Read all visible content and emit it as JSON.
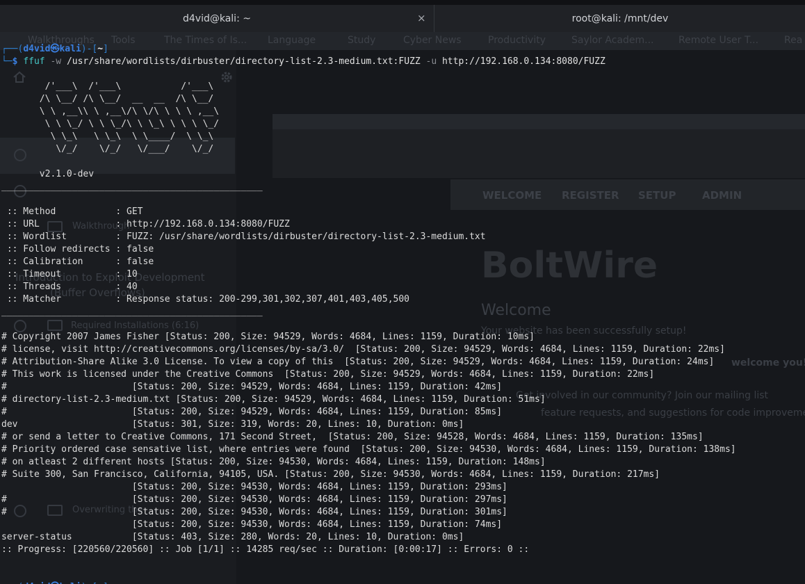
{
  "tabs": [
    {
      "title": "d4vid@kali: ~",
      "active": true,
      "close_glyph": "×"
    },
    {
      "title": "root@kali: /mnt/dev",
      "active": false
    }
  ],
  "ghost": {
    "bookmarks": [
      "Walkthroughs",
      "Tools",
      "The Times of Is...",
      "Language",
      "Study",
      "Cyber News",
      "Productivity",
      "Saylor Academ...",
      "Remote User T...",
      "Rea"
    ],
    "sidebar_items": [
      "Introduction to Exploit Development",
      "(Buffer Overflows)",
      "Required Installations (6:16)",
      "Walkthrough",
      "Overwriting the"
    ],
    "nav": [
      "WELCOME",
      "REGISTER",
      "SETUP",
      "ADMIN"
    ],
    "site_title": "BoltWire",
    "site_welcome": "Welcome",
    "site_setup": "Your website has been successfully setup!",
    "site_welcome_you": "welcome you!",
    "site_community": "Get involved in our community? Join our mailing list",
    "site_feature": "feature requests, and suggestions for code improvement a"
  },
  "prompt": {
    "user": "d4vid",
    "at": "㉿",
    "host": "kali",
    "dir": "~",
    "dollar": "$"
  },
  "command": {
    "program": "ffuf",
    "flag_w": "-w",
    "wordlist": "/usr/share/wordlists/dirbuster/directory-list-2.3-medium.txt:FUZZ",
    "flag_u": "-u",
    "url": "http://192.168.0.134:8080/FUZZ"
  },
  "banner": [
    "        /'___\\  /'___\\           /'___\\",
    "       /\\ \\__/ /\\ \\__/  __  __  /\\ \\__/",
    "       \\ \\ ,__\\\\ \\ ,__\\/\\ \\/\\ \\ \\ \\ ,__\\",
    "        \\ \\ \\_/ \\ \\ \\_/\\ \\ \\_\\ \\ \\ \\ \\_/",
    "         \\ \\_\\   \\ \\_\\  \\ \\____/  \\ \\_\\",
    "          \\/_/    \\/_/   \\/___/    \\/_/",
    "",
    "       v2.1.0-dev"
  ],
  "divider": "________________________________________________",
  "config": [
    " :: Method           : GET",
    " :: URL              : http://192.168.0.134:8080/FUZZ",
    " :: Wordlist         : FUZZ: /usr/share/wordlists/dirbuster/directory-list-2.3-medium.txt",
    " :: Follow redirects : false",
    " :: Calibration      : false",
    " :: Timeout          : 10",
    " :: Threads          : 40",
    " :: Matcher          : Response status: 200-299,301,302,307,401,403,405,500"
  ],
  "results": [
    "# Copyright 2007 James Fisher [Status: 200, Size: 94529, Words: 4684, Lines: 1159, Duration: 10ms]",
    "# license, visit http://creativecommons.org/licenses/by-sa/3.0/  [Status: 200, Size: 94529, Words: 4684, Lines: 1159, Duration: 22ms]",
    "# Attribution-Share Alike 3.0 License. To view a copy of this  [Status: 200, Size: 94529, Words: 4684, Lines: 1159, Duration: 24ms]",
    "# This work is licensed under the Creative Commons  [Status: 200, Size: 94529, Words: 4684, Lines: 1159, Duration: 22ms]",
    "#                       [Status: 200, Size: 94529, Words: 4684, Lines: 1159, Duration: 42ms]",
    "# directory-list-2.3-medium.txt [Status: 200, Size: 94529, Words: 4684, Lines: 1159, Duration: 51ms]",
    "#                       [Status: 200, Size: 94529, Words: 4684, Lines: 1159, Duration: 85ms]",
    "dev                     [Status: 301, Size: 319, Words: 20, Lines: 10, Duration: 0ms]",
    "# or send a letter to Creative Commons, 171 Second Street,  [Status: 200, Size: 94528, Words: 4684, Lines: 1159, Duration: 135ms]",
    "# Priority ordered case sensative list, where entries were found  [Status: 200, Size: 94530, Words: 4684, Lines: 1159, Duration: 138ms]",
    "# on atleast 2 different hosts [Status: 200, Size: 94530, Words: 4684, Lines: 1159, Duration: 148ms]",
    "# Suite 300, San Francisco, California, 94105, USA. [Status: 200, Size: 94530, Words: 4684, Lines: 1159, Duration: 217ms]",
    "                        [Status: 200, Size: 94530, Words: 4684, Lines: 1159, Duration: 293ms]",
    "#                       [Status: 200, Size: 94530, Words: 4684, Lines: 1159, Duration: 297ms]",
    "#                       [Status: 200, Size: 94530, Words: 4684, Lines: 1159, Duration: 301ms]",
    "                        [Status: 200, Size: 94530, Words: 4684, Lines: 1159, Duration: 74ms]",
    "server-status           [Status: 403, Size: 280, Words: 20, Lines: 10, Duration: 0ms]"
  ],
  "progress": ":: Progress: [220560/220560] :: Job [1/1] :: 14285 req/sec :: Duration: [0:00:17] :: Errors: 0 ::",
  "colors": {
    "background": "#16181c",
    "prompt_blue": "#3a7fe0",
    "command_cyan": "#46c8c8",
    "text": "#dcdcdc"
  },
  "icons": [
    "home-icon",
    "gear-icon",
    "close-icon"
  ]
}
